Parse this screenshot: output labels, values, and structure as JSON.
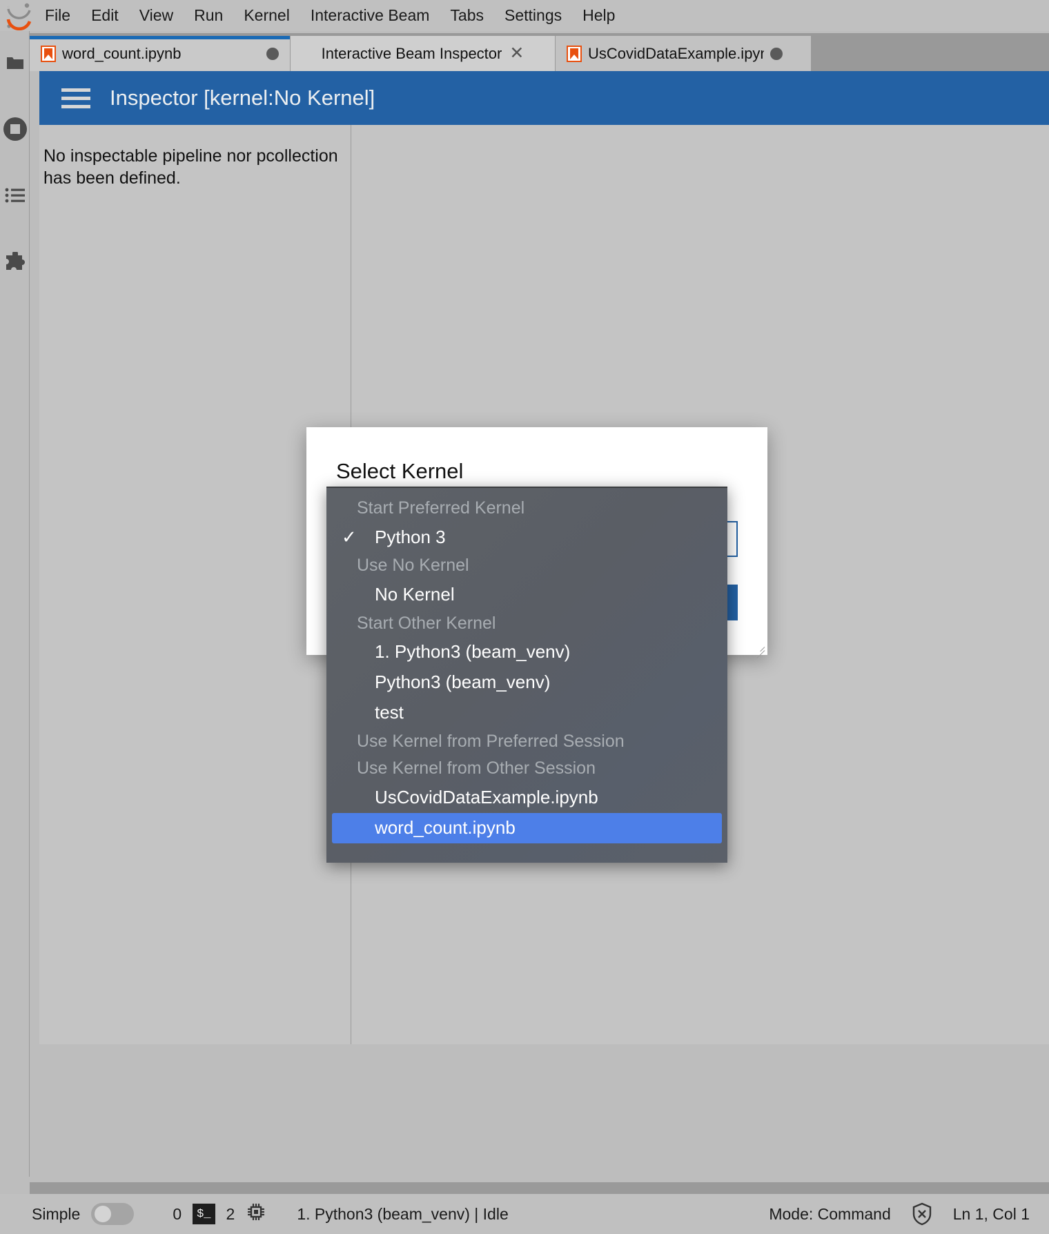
{
  "menubar": {
    "logo_icon": "jupyter-logo-icon",
    "items": [
      {
        "label": "File"
      },
      {
        "label": "Edit"
      },
      {
        "label": "View"
      },
      {
        "label": "Run"
      },
      {
        "label": "Kernel"
      },
      {
        "label": "Interactive Beam"
      },
      {
        "label": "Tabs"
      },
      {
        "label": "Settings"
      },
      {
        "label": "Help"
      }
    ]
  },
  "activitybar": {
    "items": [
      {
        "icon": "folder-icon",
        "name": "file-browser"
      },
      {
        "icon": "stop-circle-icon",
        "name": "running-terminals-and-kernels"
      },
      {
        "icon": "list-icon",
        "name": "command-palette"
      },
      {
        "icon": "puzzle-icon",
        "name": "extension-manager"
      }
    ]
  },
  "tabs": [
    {
      "label": "word_count.ipynb",
      "icon": "notebook-icon",
      "state": "dirty",
      "dot": "●"
    },
    {
      "label": "Interactive Beam Inspector",
      "icon": "none",
      "close": "✕"
    },
    {
      "label": "UsCovidDataExample.ipynb",
      "icon": "notebook-icon",
      "state": "dirty",
      "dot": "●"
    }
  ],
  "inspector": {
    "menu_icon": "hamburger-icon",
    "title": "Inspector [kernel:No Kernel]",
    "message": "No inspectable pipeline nor pcollection has been defined.",
    "header_color": "#2361a4"
  },
  "dialog": {
    "title": "Select Kernel",
    "quote_fragment": "\"",
    "select_value": "",
    "accept_label": "",
    "accent_color": "#2361a4"
  },
  "kernel_dropdown": {
    "highlight_color": "#4d7fe8",
    "check_glyph": "✓",
    "groups": [
      {
        "header": "Start Preferred Kernel",
        "items": [
          {
            "label": "Python 3",
            "checked": true,
            "selected": false
          }
        ]
      },
      {
        "header": "Use No Kernel",
        "items": [
          {
            "label": "No Kernel",
            "checked": false,
            "selected": false
          }
        ]
      },
      {
        "header": "Start Other Kernel",
        "items": [
          {
            "label": "1. Python3 (beam_venv)",
            "checked": false,
            "selected": false
          },
          {
            "label": "Python3 (beam_venv)",
            "checked": false,
            "selected": false
          },
          {
            "label": "test",
            "checked": false,
            "selected": false
          }
        ]
      },
      {
        "header": "Use Kernel from Preferred Session",
        "items": []
      },
      {
        "header": "Use Kernel from Other Session",
        "items": [
          {
            "label": "UsCovidDataExample.ipynb",
            "checked": false,
            "selected": false
          },
          {
            "label": "word_count.ipynb",
            "checked": false,
            "selected": true
          }
        ]
      }
    ]
  },
  "statusbar": {
    "mode_toggle_label": "Simple",
    "terminals_count": "0",
    "terminal_icon": "$_",
    "kernels_count": "2",
    "kernel_icon": "cpu-chip-icon",
    "kernel_status": "1. Python3 (beam_venv) | Idle",
    "mode": "Mode: Command",
    "trust_icon": "shield-x-icon",
    "cursor_position": "Ln 1, Col 1"
  }
}
